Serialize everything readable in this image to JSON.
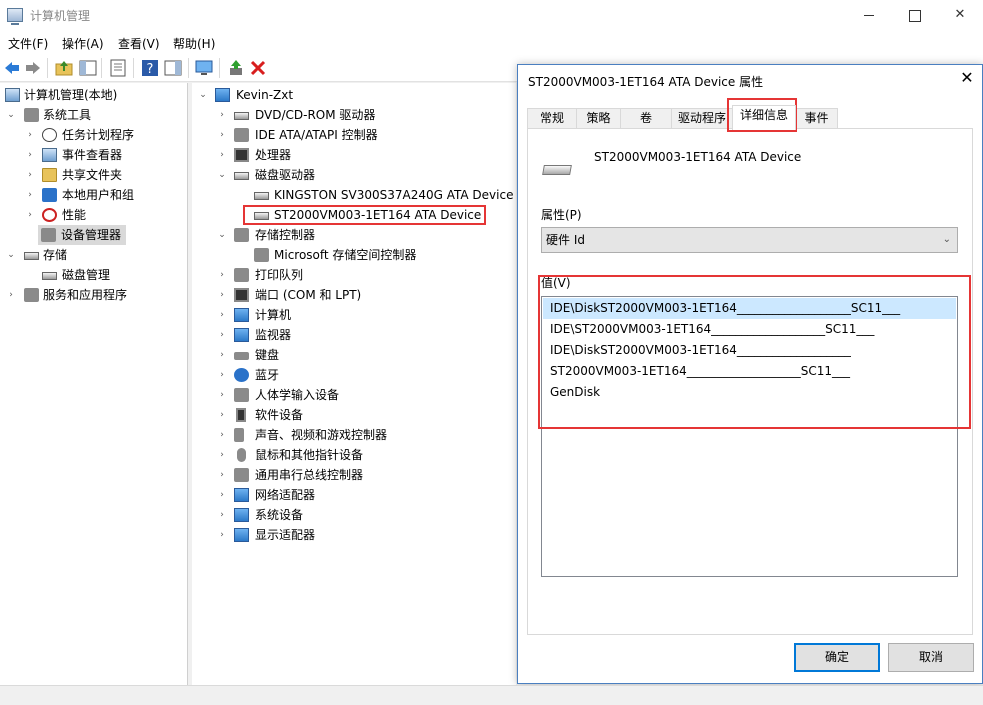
{
  "window": {
    "title": "计算机管理",
    "controls": {
      "minimize": "—",
      "maximize": "☐",
      "close": "✕"
    }
  },
  "menu": [
    "文件(F)",
    "操作(A)",
    "查看(V)",
    "帮助(H)"
  ],
  "toolbar": {
    "icons": [
      "back-icon",
      "forward-icon",
      "up-folder-icon",
      "show-hide-tree-icon",
      "properties-icon",
      "help-icon",
      "action-pane-icon",
      "monitor-icon",
      "update-driver-icon",
      "uninstall-icon"
    ]
  },
  "left_tree": [
    {
      "label": "计算机管理(本地)",
      "icon": "computer-management-icon"
    },
    {
      "label": "系统工具",
      "icon": "tools-icon"
    },
    {
      "label": "任务计划程序",
      "icon": "clock-icon"
    },
    {
      "label": "事件查看器",
      "icon": "event-viewer-icon"
    },
    {
      "label": "共享文件夹",
      "icon": "shared-folder-icon"
    },
    {
      "label": "本地用户和组",
      "icon": "users-icon"
    },
    {
      "label": "性能",
      "icon": "performance-icon"
    },
    {
      "label": "设备管理器",
      "icon": "device-manager-icon",
      "selected": true
    },
    {
      "label": "存储",
      "icon": "storage-icon"
    },
    {
      "label": "磁盘管理",
      "icon": "disk-management-icon"
    },
    {
      "label": "服务和应用程序",
      "icon": "services-icon"
    }
  ],
  "device_tree": {
    "root": "Kevin-Zxt",
    "items": [
      {
        "label": "DVD/CD-ROM 驱动器",
        "icon": "dvd-icon"
      },
      {
        "label": "IDE ATA/ATAPI 控制器",
        "icon": "ide-controller-icon"
      },
      {
        "label": "处理器",
        "icon": "processor-icon"
      },
      {
        "label": "磁盘驱动器",
        "icon": "disk-drive-icon"
      },
      {
        "label": "KINGSTON SV300S37A240G ATA Device",
        "icon": "disk-icon"
      },
      {
        "label": "ST2000VM003-1ET164 ATA Device",
        "icon": "disk-icon"
      },
      {
        "label": "存储控制器",
        "icon": "storage-controller-icon"
      },
      {
        "label": "Microsoft 存储空间控制器",
        "icon": "storage-controller-icon"
      },
      {
        "label": "打印队列",
        "icon": "printer-icon"
      },
      {
        "label": "端口 (COM 和 LPT)",
        "icon": "port-icon"
      },
      {
        "label": "计算机",
        "icon": "computer-icon"
      },
      {
        "label": "监视器",
        "icon": "monitor-icon"
      },
      {
        "label": "键盘",
        "icon": "keyboard-icon"
      },
      {
        "label": "蓝牙",
        "icon": "bluetooth-icon"
      },
      {
        "label": "人体学输入设备",
        "icon": "hid-icon"
      },
      {
        "label": "软件设备",
        "icon": "software-device-icon"
      },
      {
        "label": "声音、视频和游戏控制器",
        "icon": "audio-icon"
      },
      {
        "label": "鼠标和其他指针设备",
        "icon": "mouse-icon"
      },
      {
        "label": "通用串行总线控制器",
        "icon": "usb-icon"
      },
      {
        "label": "网络适配器",
        "icon": "network-icon"
      },
      {
        "label": "系统设备",
        "icon": "system-device-icon"
      },
      {
        "label": "显示适配器",
        "icon": "display-adapter-icon"
      }
    ]
  },
  "dialog": {
    "title": "ST2000VM003-1ET164 ATA Device 属性",
    "tabs": [
      "常规",
      "策略",
      "卷",
      "驱动程序",
      "详细信息",
      "事件"
    ],
    "active_tab": "详细信息",
    "device_name": "ST2000VM003-1ET164 ATA Device",
    "property_label": "属性(P)",
    "property_value": "硬件 Id",
    "value_label": "值(V)",
    "values": [
      "IDE\\DiskST2000VM003-1ET164___________________SC11___",
      "IDE\\ST2000VM003-1ET164___________________SC11___",
      "IDE\\DiskST2000VM003-1ET164___________________",
      "ST2000VM003-1ET164___________________SC11___",
      "GenDisk"
    ],
    "ok_label": "确定",
    "cancel_label": "取消"
  },
  "colors": {
    "selection": "#cce8ff",
    "highlight_box": "#e53535",
    "accent": "#0078d7"
  }
}
